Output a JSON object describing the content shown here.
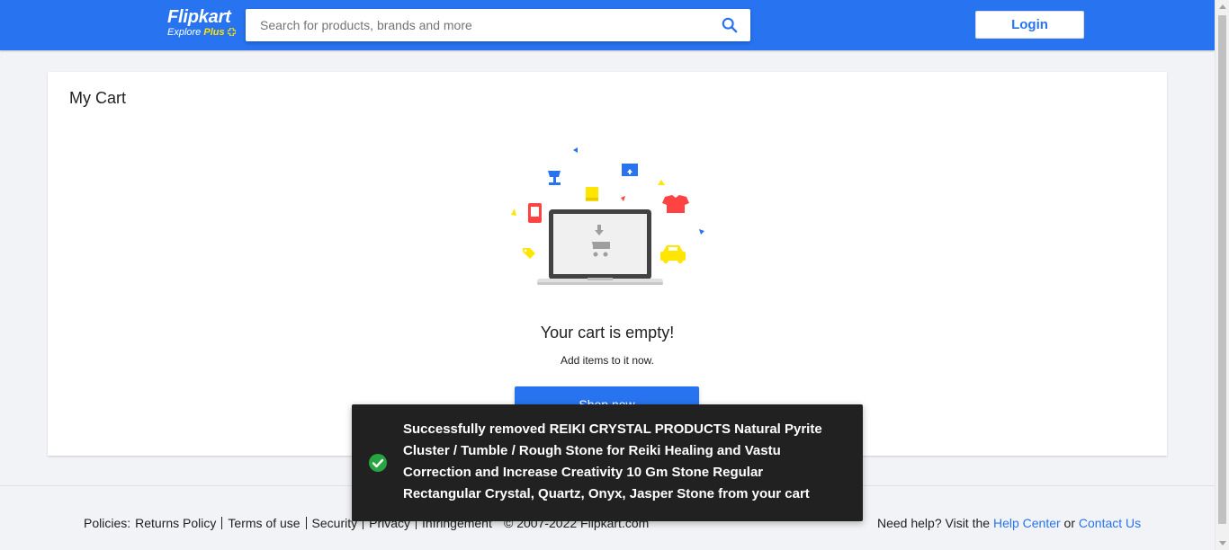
{
  "header": {
    "logo_text": "Flipkart",
    "logo_sub_text": "Explore",
    "logo_plus_text": "Plus",
    "search_placeholder": "Search for products, brands and more",
    "login_label": "Login",
    "brand_color": "#2874f0"
  },
  "cart": {
    "title": "My Cart",
    "empty_title": "Your cart is empty!",
    "empty_subtitle": "Add items to it now.",
    "shop_now_label": "Shop now"
  },
  "toast": {
    "message": "Successfully removed REIKI CRYSTAL PRODUCTS Natural Pyrite Cluster / Tumble / Rough Stone for Reiki Healing and Vastu Correction and Increase Creativity 10 Gm Stone Regular Rectangular Crystal, Quartz, Onyx, Jasper Stone from your cart",
    "icon": "check-circle-icon",
    "icon_color": "#26a541"
  },
  "footer": {
    "policies_label": "Policies:",
    "policy_links": [
      "Returns Policy",
      "Terms of use",
      "Security",
      "Privacy",
      "Infringement"
    ],
    "copyright": "© 2007-2022 Flipkart.com",
    "help_prefix": "Need help? Visit the",
    "help_center_label": "Help Center",
    "help_or": "or",
    "contact_us_label": "Contact Us"
  }
}
